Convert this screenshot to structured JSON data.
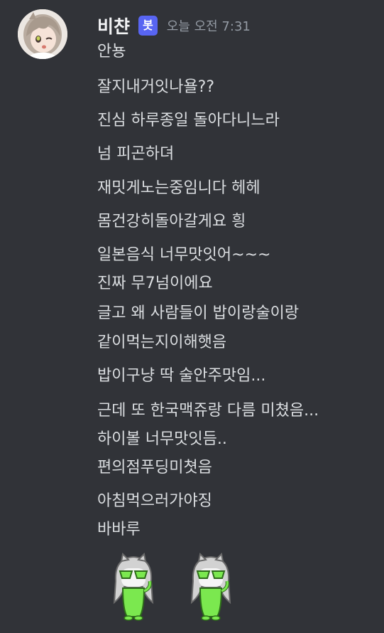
{
  "message": {
    "username": "비챤",
    "bot_tag": "봇",
    "timestamp": "오늘 오전 7:31",
    "lines": [
      "안뇽",
      "잘지내거잇나욜??",
      "진심 하루종일 돌아다니느라",
      "넘 피곤하뎌",
      "재밋게노는중임니다 헤헤",
      "몸건강히돌아갈게요 힁",
      "일본음식 너무맛잇어~~~",
      "진짜 무7넘이에요",
      "글고 왜 사람들이 밥이랑술이랑",
      "같이먹는지이해햇음",
      "밥이구냥 딱 술안주맛임...",
      "근데 또 한국맥쥬랑 다름 미쳤음...",
      "하이볼 너무맛잇듬..",
      "편의점푸딩미쳣음",
      "아침먹으러가야징",
      "바바루"
    ],
    "stickers": [
      "sticker-green-cat",
      "sticker-green-cat"
    ]
  },
  "colors": {
    "background": "#313338",
    "username": "#f2f3f5",
    "text": "#dbdee1",
    "timestamp": "#949ba4",
    "bot_tag": "#5865f2",
    "sticker_green": "#7be84f"
  }
}
